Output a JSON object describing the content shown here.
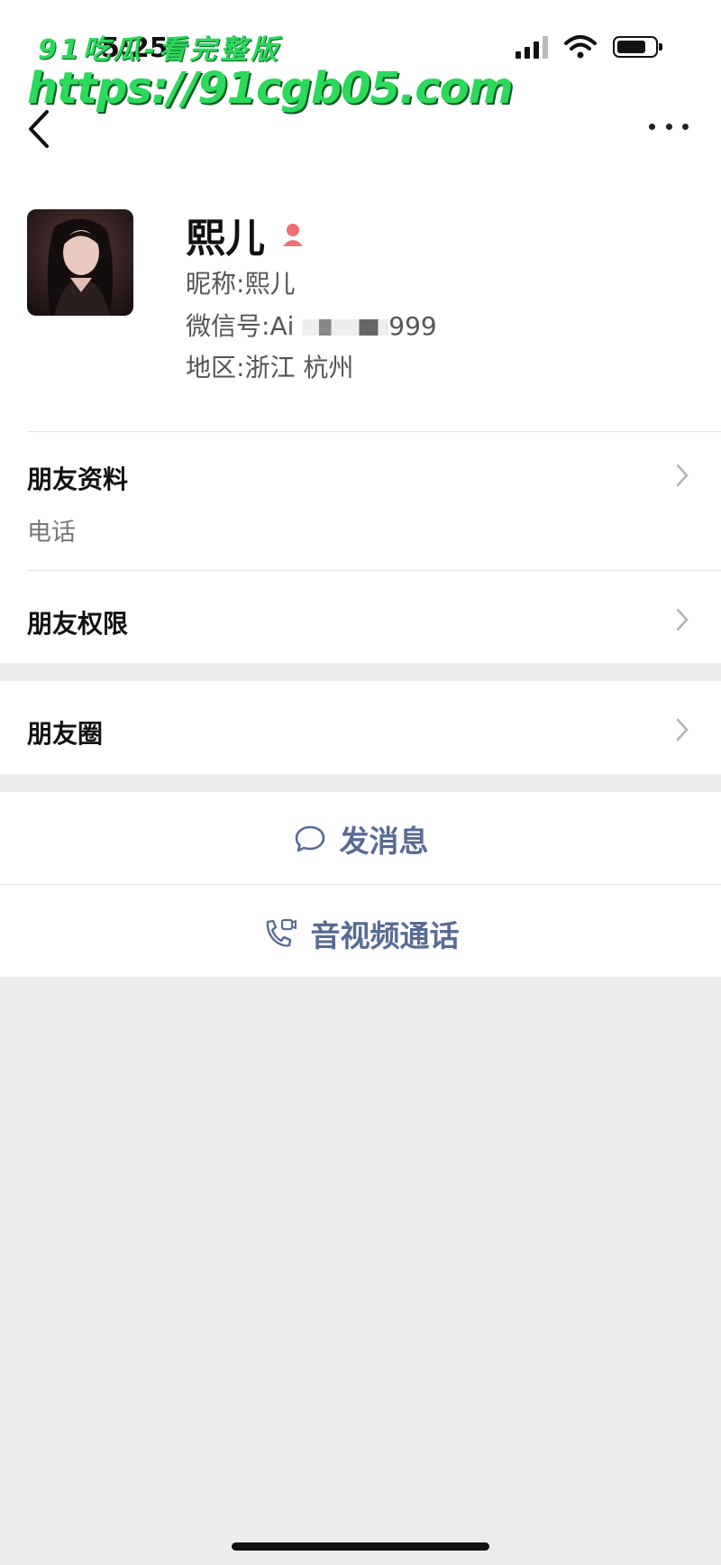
{
  "status_bar": {
    "time": "5:25"
  },
  "watermark": {
    "line1": "91吃瓜-看完整版",
    "line2": "https://91cgb05.com"
  },
  "profile": {
    "name": "熙儿",
    "nickname_label": "昵称:",
    "nickname": "熙儿",
    "wechat_label": "微信号:",
    "wechat_prefix": "Ai",
    "wechat_suffix": "999",
    "region_label": "地区:",
    "region": "浙江 杭州"
  },
  "rows": {
    "friend_info": "朋友资料",
    "phone_label": "电话",
    "friend_permissions": "朋友权限",
    "moments": "朋友圈"
  },
  "actions": {
    "send_message": "发消息",
    "av_call": "音视频通话"
  },
  "colors": {
    "link": "#576b95",
    "watermark": "#2bd95b"
  }
}
